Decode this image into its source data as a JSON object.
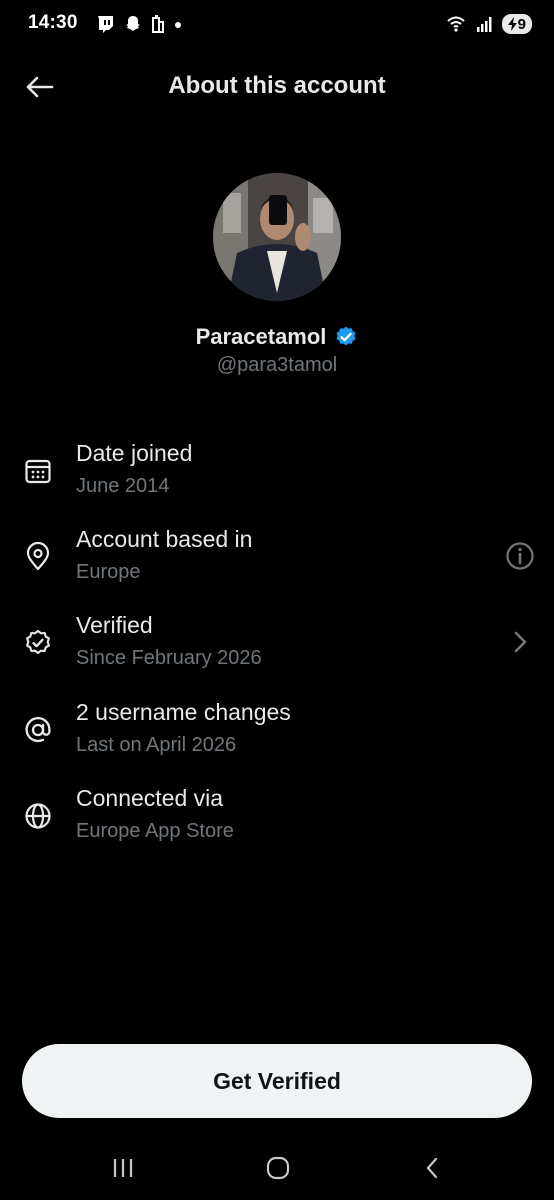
{
  "status_bar": {
    "time": "14:30",
    "battery": "9",
    "left_icons": [
      "twitch-icon",
      "snapchat-icon",
      "app-icon",
      "dot-icon"
    ],
    "right_icons": [
      "wifi-icon",
      "signal-icon",
      "battery-icon"
    ]
  },
  "header": {
    "title": "About this account",
    "back_icon": "arrow-left-icon"
  },
  "profile": {
    "display_name": "Paracetamol",
    "username": "@para3tamol",
    "verified_badge_color": "#1d9bf0"
  },
  "rows": [
    {
      "icon": "calendar-icon",
      "title": "Date joined",
      "subtitle": "June 2014",
      "right_icon": ""
    },
    {
      "icon": "location-pin-icon",
      "title": "Account based in",
      "subtitle": "Europe",
      "right_icon": "info-icon"
    },
    {
      "icon": "verified-badge-icon",
      "title": "Verified",
      "subtitle": "Since February 2026",
      "right_icon": "chevron-right-icon"
    },
    {
      "icon": "at-sign-icon",
      "title": "2 username changes",
      "subtitle": "Last on April 2026",
      "right_icon": ""
    },
    {
      "icon": "globe-icon",
      "title": "Connected via",
      "subtitle": "Europe App Store",
      "right_icon": ""
    }
  ],
  "cta": {
    "label": "Get Verified"
  },
  "nav_bar": {
    "items": [
      "recents-icon",
      "home-icon",
      "back-icon"
    ]
  },
  "colors": {
    "background": "#000000",
    "primary_text": "#e7e9ea",
    "secondary_text": "#71767b",
    "accent": "#1d9bf0"
  }
}
